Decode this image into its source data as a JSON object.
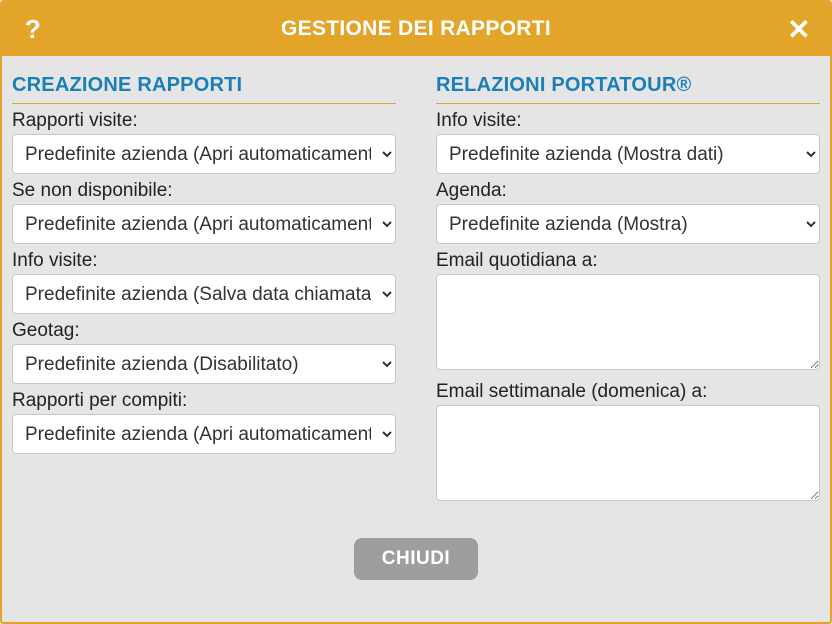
{
  "titlebar": {
    "help_label": "?",
    "title": "GESTIONE DEI RAPPORTI",
    "close_label": "✕"
  },
  "left": {
    "section_title": "CREAZIONE RAPPORTI",
    "fields": {
      "rapporti_visite": {
        "label": "Rapporti visite:",
        "value": "Predefinite azienda (Apri automaticamente)"
      },
      "se_non_disponibile": {
        "label": "Se non disponibile:",
        "value": "Predefinite azienda (Apri automaticamente)"
      },
      "info_visite": {
        "label": "Info visite:",
        "value": "Predefinite azienda (Salva data chiamata)"
      },
      "geotag": {
        "label": "Geotag:",
        "value": "Predefinite azienda (Disabilitato)"
      },
      "rapporti_compiti": {
        "label": "Rapporti per compiti:",
        "value": "Predefinite azienda (Apri automaticamente)"
      }
    }
  },
  "right": {
    "section_title": "RELAZIONI PORTATOUR®",
    "fields": {
      "info_visite": {
        "label": "Info visite:",
        "value": "Predefinite azienda (Mostra dati)"
      },
      "agenda": {
        "label": "Agenda:",
        "value": "Predefinite azienda (Mostra)"
      },
      "email_quotidiana": {
        "label": "Email quotidiana a:",
        "value": ""
      },
      "email_settimanale": {
        "label": "Email settimanale (domenica) a:",
        "value": ""
      }
    }
  },
  "footer": {
    "close_button": "CHIUDI"
  }
}
